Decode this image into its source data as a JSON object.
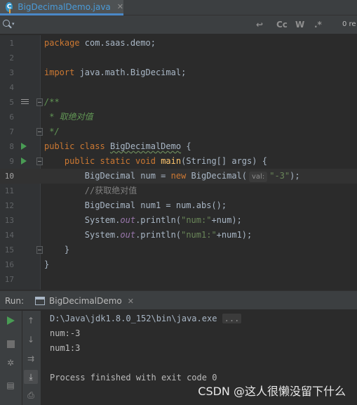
{
  "tab": {
    "label": "BigDecimalDemo.java",
    "close": "✕",
    "icon_letter": "C",
    "icon": "java-class-icon"
  },
  "searchbar": {
    "search_icon": "search-icon",
    "regex_icon": "↩",
    "case_label": "Cc",
    "words_label": "W",
    "regex_label": ".*",
    "occurrences": "0 re"
  },
  "editor": {
    "lines": [
      {
        "num": "1"
      },
      {
        "num": "2"
      },
      {
        "num": "3"
      },
      {
        "num": "4"
      },
      {
        "num": "5"
      },
      {
        "num": "6"
      },
      {
        "num": "7"
      },
      {
        "num": "8"
      },
      {
        "num": "9"
      },
      {
        "num": "10"
      },
      {
        "num": "11"
      },
      {
        "num": "12"
      },
      {
        "num": "13"
      },
      {
        "num": "14"
      },
      {
        "num": "15"
      },
      {
        "num": "16"
      },
      {
        "num": "17"
      }
    ],
    "code": {
      "l1_kw": "package",
      "l1_rest": " com.saas.demo;",
      "l3_kw": "import",
      "l3_rest": " java.math.BigDecimal;",
      "l5": "/**",
      "l6": " * 取绝对值",
      "l7": " */",
      "l8_kw": "public class",
      "l8_name": "BigDecimalDemo",
      "l8_rest": " {",
      "l9_kw": "public static void",
      "l9_fn": "main",
      "l9_rest": "(String[] args) {",
      "l10_type": "BigDecimal num = ",
      "l10_new": "new",
      "l10_cls": " BigDecimal(",
      "l10_hint_label": "val:",
      "l10_str": "\"-3\"",
      "l10_end": ");",
      "l11": "//获取绝对值",
      "l12": "BigDecimal num1 = num.abs();",
      "l13_a": "System.",
      "l13_out": "out",
      "l13_b": ".println(",
      "l13_str": "\"num:\"",
      "l13_c": "+num);",
      "l14_a": "System.",
      "l14_out": "out",
      "l14_b": ".println(",
      "l14_str": "\"num1:\"",
      "l14_c": "+num1);",
      "l15": "}",
      "l16": "}"
    }
  },
  "run": {
    "title": "Run:",
    "tab_label": "BigDecimalDemo",
    "tab_close": "✕",
    "console": {
      "command": "D:\\Java\\jdk1.8.0_152\\bin\\java.exe",
      "ellipsis": "...",
      "out1": "num:-3",
      "out2": "num1:3",
      "exit": "Process finished with exit code 0"
    }
  },
  "watermark": "CSDN @这人很懒没留下什么"
}
